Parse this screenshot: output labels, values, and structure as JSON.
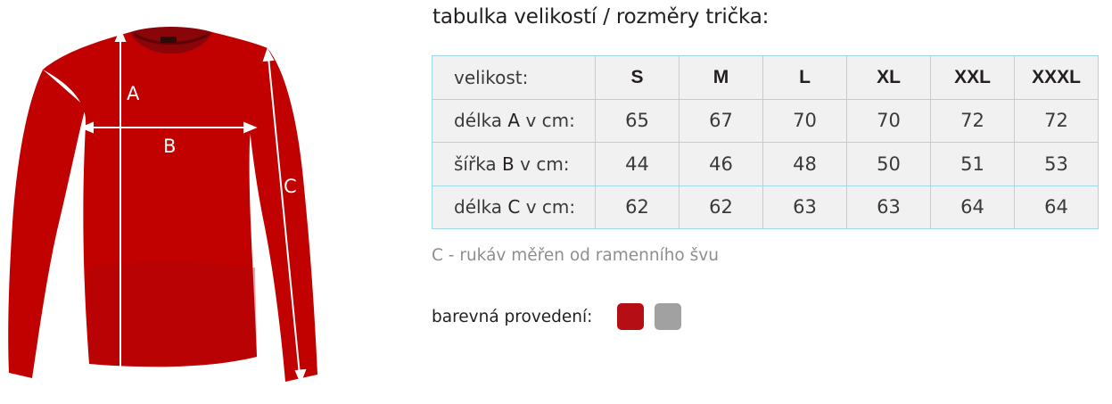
{
  "title": "tabulka velikostí / rozměry trička:",
  "dimension_letters": {
    "a": "A",
    "b": "B",
    "c": "C"
  },
  "shirt_color": "#c10000",
  "table": {
    "header": {
      "label": "velikost:",
      "sizes": [
        "S",
        "M",
        "L",
        "XL",
        "XXL",
        "XXXL"
      ]
    },
    "rows": [
      {
        "prefix": "délka ",
        "letter": "A",
        "suffix": " v cm:",
        "values": [
          "65",
          "67",
          "70",
          "70",
          "72",
          "72"
        ]
      },
      {
        "prefix": "šířka ",
        "letter": "B",
        "suffix": " v cm:",
        "values": [
          "44",
          "46",
          "48",
          "50",
          "51",
          "53"
        ]
      },
      {
        "prefix": "délka ",
        "letter": "C",
        "suffix": " v cm:",
        "values": [
          "62",
          "62",
          "63",
          "63",
          "64",
          "64"
        ]
      }
    ]
  },
  "note": "C - rukáv měřen od ramenního švu",
  "colors": {
    "label": "barevná provedení:",
    "swatches": [
      "#b50e14",
      "#a1a1a1"
    ]
  }
}
